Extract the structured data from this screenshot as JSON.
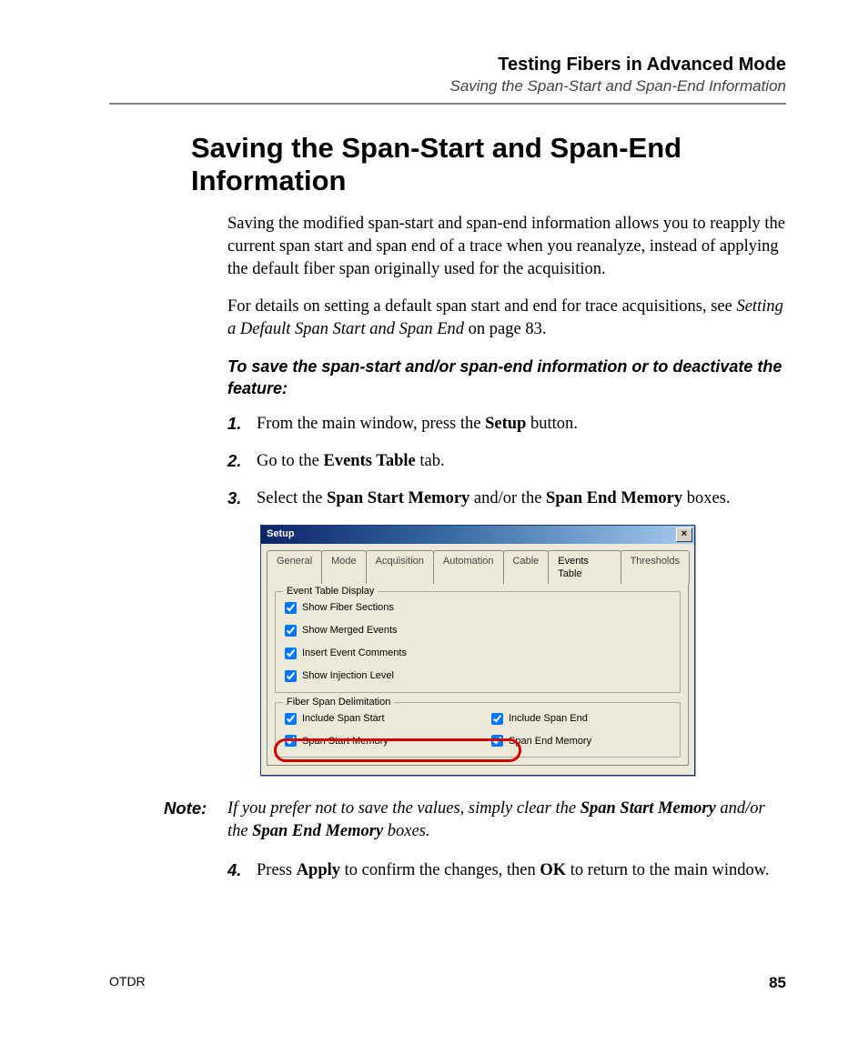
{
  "header": {
    "chapter": "Testing Fibers in Advanced Mode",
    "section": "Saving the Span-Start and Span-End Information"
  },
  "title": "Saving the Span-Start and Span-End Information",
  "para1": "Saving the modified span-start and span-end information allows you to reapply the current span start and span end of a trace when you reanalyze, instead of applying the default fiber span originally used for the acquisition.",
  "para2_a": "For details on setting a default span start and end for trace acquisitions, see ",
  "para2_i": "Setting a Default Span Start and Span End",
  "para2_b": " on page 83.",
  "subhead": "To save the span-start and/or span-end information or to deactivate the feature:",
  "steps": {
    "s1_num": "1.",
    "s1_a": "From the main window, press the ",
    "s1_b": "Setup",
    "s1_c": " button.",
    "s2_num": "2.",
    "s2_a": "Go to the ",
    "s2_b": "Events Table",
    "s2_c": " tab.",
    "s3_num": "3.",
    "s3_a": "Select the ",
    "s3_b": "Span Start Memory",
    "s3_c": " and/or the ",
    "s3_d": "Span End Memory",
    "s3_e": " boxes.",
    "s4_num": "4.",
    "s4_a": "Press ",
    "s4_b": "Apply",
    "s4_c": " to confirm the changes, then ",
    "s4_d": "OK",
    "s4_e": " to return to the main window."
  },
  "note": {
    "label": "Note:",
    "a": "If you prefer not to save the values, simply clear the ",
    "b": "Span Start Memory",
    "c": " and/or the ",
    "d": "Span End Memory",
    "e": " boxes."
  },
  "dialog": {
    "title": "Setup",
    "close": "×",
    "tabs": {
      "general": "General",
      "mode": "Mode",
      "acquisition": "Acquisition",
      "automation": "Automation",
      "cable": "Cable",
      "events_table": "Events Table",
      "thresholds": "Thresholds"
    },
    "group1_title": "Event Table Display",
    "chk_fiber_sections": "Show Fiber Sections",
    "chk_merged_events": "Show Merged Events",
    "chk_insert_comments": "Insert Event Comments",
    "chk_injection_level": "Show Injection Level",
    "group2_title": "Fiber Span Delimitation",
    "chk_include_span_start": "Include Span Start",
    "chk_include_span_end": "Include Span End",
    "chk_span_start_memory": "Span Start Memory",
    "chk_span_end_memory": "Span End Memory"
  },
  "footer": {
    "left": "OTDR",
    "right": "85"
  }
}
